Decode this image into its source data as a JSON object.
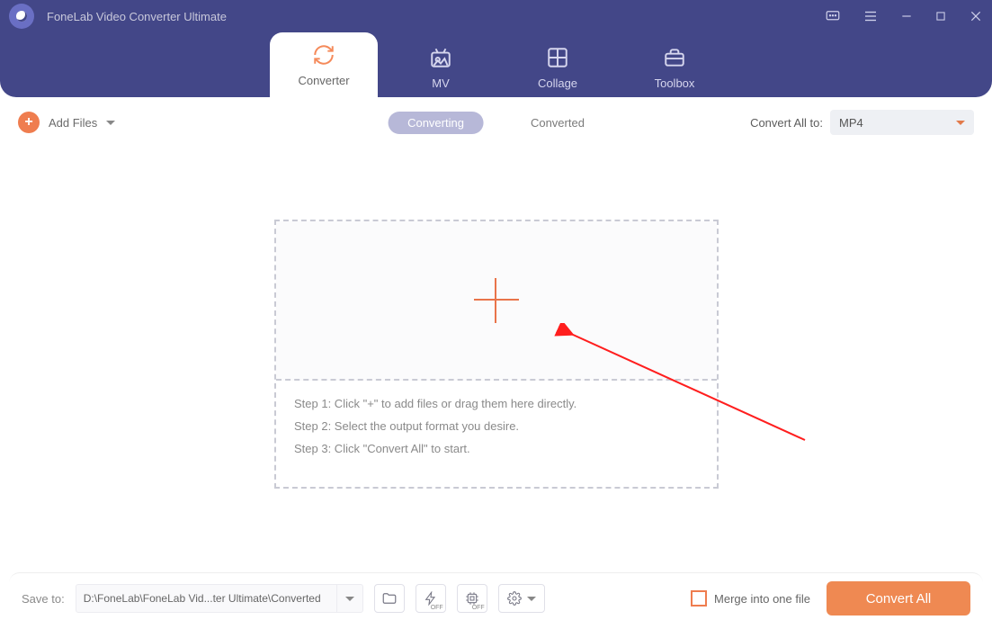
{
  "app": {
    "title": "FoneLab Video Converter Ultimate"
  },
  "nav": {
    "tabs": [
      {
        "label": "Converter",
        "active": true
      },
      {
        "label": "MV",
        "active": false
      },
      {
        "label": "Collage",
        "active": false
      },
      {
        "label": "Toolbox",
        "active": false
      }
    ]
  },
  "toolbar": {
    "add_files": "Add Files",
    "sub_tabs": [
      {
        "label": "Converting",
        "active": true
      },
      {
        "label": "Converted",
        "active": false
      }
    ],
    "convert_all_to_label": "Convert All to:",
    "format_selected": "MP4"
  },
  "dropzone": {
    "steps": [
      "Step 1: Click \"+\" to add files or drag them here directly.",
      "Step 2: Select the output format you desire.",
      "Step 3: Click \"Convert All\" to start."
    ]
  },
  "footer": {
    "save_to_label": "Save to:",
    "save_path": "D:\\FoneLab\\FoneLab Vid...ter Ultimate\\Converted",
    "merge_label": "Merge into one file",
    "convert_button": "Convert All",
    "icon_badges": {
      "hw": "OFF",
      "gpu": "OFF"
    }
  }
}
